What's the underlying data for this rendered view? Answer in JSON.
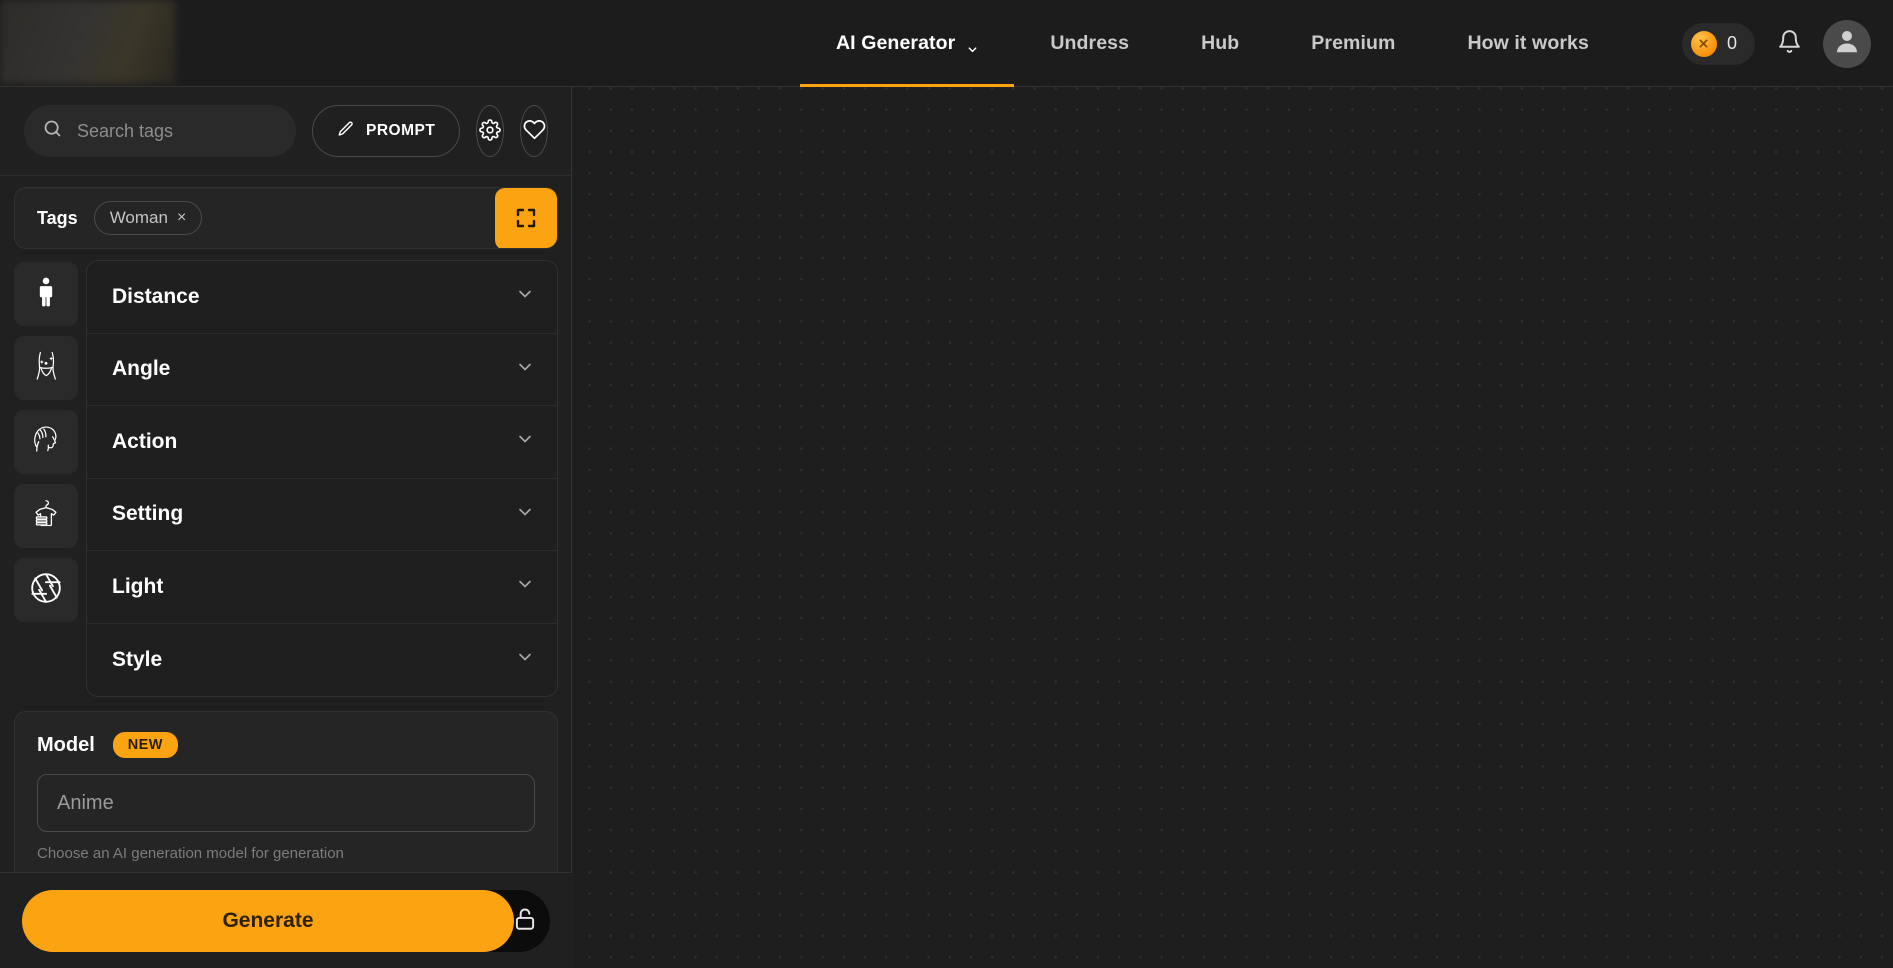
{
  "header": {
    "logo_name": "site-logo-blurred",
    "nav": [
      {
        "label": "AI Generator",
        "active": true,
        "has_caret": true
      },
      {
        "label": "Undress",
        "active": false,
        "has_caret": false
      },
      {
        "label": "Hub",
        "active": false,
        "has_caret": false
      },
      {
        "label": "Premium",
        "active": false,
        "has_caret": false
      },
      {
        "label": "How it works",
        "active": false,
        "has_caret": false
      }
    ],
    "coins": {
      "value": "0",
      "icon": "coin-icon"
    },
    "bell_icon": "notification-bell-icon",
    "avatar_icon": "user-avatar-icon"
  },
  "sidebar": {
    "search": {
      "placeholder": "Search tags",
      "value": "",
      "icon": "search-icon"
    },
    "prompt_button": {
      "label": "PROMPT",
      "icon": "pencil-icon"
    },
    "settings_button": {
      "icon": "gear-icon"
    },
    "favorites_button": {
      "icon": "heart-icon"
    },
    "tags": {
      "label": "Tags",
      "chips": [
        {
          "label": "Woman",
          "remove": "×"
        }
      ],
      "expand_button": {
        "icon": "fullscreen-expand-icon"
      }
    },
    "icon_rail": [
      {
        "name": "person-standing-icon"
      },
      {
        "name": "body-torso-icon"
      },
      {
        "name": "face-profile-icon"
      },
      {
        "name": "clothing-hanger-icon"
      },
      {
        "name": "camera-aperture-icon"
      }
    ],
    "accordion": [
      {
        "label": "Distance",
        "expanded": false
      },
      {
        "label": "Angle",
        "expanded": false
      },
      {
        "label": "Action",
        "expanded": false
      },
      {
        "label": "Setting",
        "expanded": false
      },
      {
        "label": "Light",
        "expanded": false
      },
      {
        "label": "Style",
        "expanded": false
      }
    ],
    "model": {
      "label": "Model",
      "badge": "NEW",
      "selected": "Anime",
      "placeholder": "Anime",
      "hint": "Choose an AI generation model for generation"
    },
    "footer": {
      "generate_label": "Generate",
      "lock_icon": "padlock-open-icon"
    }
  },
  "canvas": {
    "name": "generation-canvas",
    "background": "#1e1e1e",
    "dot_color": "#2f2f2f"
  },
  "colors": {
    "accent": "#FCA311",
    "page_bg": "#202020",
    "panel_bg": "#252525",
    "canvas_bg": "#1e1e1e",
    "text_primary": "#ffffff",
    "text_muted": "#8d8d8d",
    "border": "#343434"
  }
}
